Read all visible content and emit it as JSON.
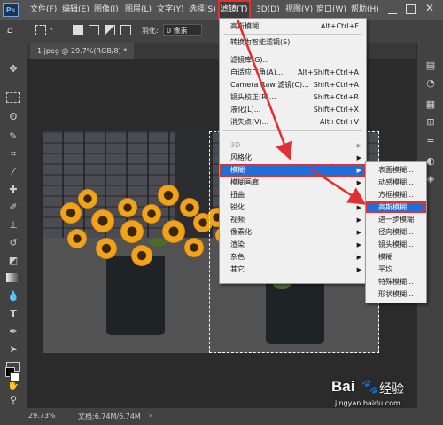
{
  "menubar": {
    "logo": "Ps",
    "items": [
      "文件(F)",
      "编辑(E)",
      "图像(I)",
      "图层(L)",
      "文字(Y)",
      "选择(S)",
      "滤镜(T)",
      "3D(D)",
      "视图(V)",
      "窗口(W)",
      "帮助(H)"
    ]
  },
  "options": {
    "feather_label": "羽化:",
    "feather_value": "0 像素"
  },
  "document": {
    "tab_label": "1.jpeg @ 29.7%(RGB/8) *"
  },
  "status": {
    "zoom": "29.73%",
    "doc_info": "文档:6.74M/6.74M"
  },
  "filter_menu": {
    "items": [
      {
        "label": "高斯模糊",
        "shortcut": "Alt+Ctrl+F"
      },
      {
        "label": "转换为智能滤镜(S)",
        "shortcut": ""
      },
      {
        "label": "滤镜库(G)...",
        "shortcut": ""
      },
      {
        "label": "自适应广角(A)...",
        "shortcut": "Alt+Shift+Ctrl+A"
      },
      {
        "label": "Camera Raw 滤镜(C)...",
        "shortcut": "Shift+Ctrl+A"
      },
      {
        "label": "镜头校正(R)...",
        "shortcut": "Shift+Ctrl+R"
      },
      {
        "label": "液化(L)...",
        "shortcut": "Shift+Ctrl+X"
      },
      {
        "label": "消失点(V)...",
        "shortcut": "Alt+Ctrl+V"
      },
      {
        "label": "3D",
        "shortcut": ""
      },
      {
        "label": "风格化",
        "shortcut": ""
      },
      {
        "label": "模糊",
        "shortcut": ""
      },
      {
        "label": "模糊画廊",
        "shortcut": ""
      },
      {
        "label": "扭曲",
        "shortcut": ""
      },
      {
        "label": "锐化",
        "shortcut": ""
      },
      {
        "label": "视频",
        "shortcut": ""
      },
      {
        "label": "像素化",
        "shortcut": ""
      },
      {
        "label": "渲染",
        "shortcut": ""
      },
      {
        "label": "杂色",
        "shortcut": ""
      },
      {
        "label": "其它",
        "shortcut": ""
      }
    ]
  },
  "blur_submenu": {
    "items": [
      "表面模糊...",
      "动感模糊...",
      "方框模糊...",
      "高斯模糊...",
      "进一步模糊",
      "径向模糊...",
      "镜头模糊...",
      "模糊",
      "平均",
      "特殊模糊...",
      "形状模糊..."
    ]
  },
  "watermark": {
    "brand": "Bai",
    "brand2": "经验",
    "url": "jingyan.baidu.com"
  },
  "colors": {
    "highlight": "#1e6fd9",
    "annotation": "#e03030"
  }
}
